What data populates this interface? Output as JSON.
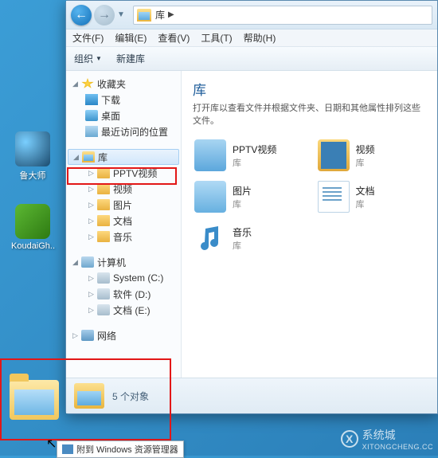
{
  "desktop": {
    "icons": [
      {
        "label": "鲁大师"
      },
      {
        "label": "KoudaiGh.."
      }
    ]
  },
  "nav": {
    "back_arrow": "←",
    "fwd_arrow": "→",
    "dropdown": "▼",
    "breadcrumb_label": "库",
    "breadcrumb_arrow": "▶"
  },
  "menu": {
    "items": [
      "文件(F)",
      "编辑(E)",
      "查看(V)",
      "工具(T)",
      "帮助(H)"
    ]
  },
  "toolbar": {
    "organize": "组织",
    "new_library": "新建库",
    "drop": "▼"
  },
  "tree": {
    "favorites": {
      "label": "收藏夹",
      "items": [
        "下载",
        "桌面",
        "最近访问的位置"
      ]
    },
    "libraries": {
      "label": "库",
      "items": [
        "PPTV视频",
        "视频",
        "图片",
        "文档",
        "音乐"
      ]
    },
    "computer": {
      "label": "计算机",
      "items": [
        "System (C:)",
        "软件 (D:)",
        "文档 (E:)"
      ]
    },
    "network": {
      "label": "网络"
    },
    "expander": "▷",
    "expander_down": "◢"
  },
  "content": {
    "title": "库",
    "subtitle": "打开库以查看文件并根据文件夹、日期和其他属性排列这些文件。",
    "items": [
      {
        "name": "PPTV视频",
        "sub": "库"
      },
      {
        "name": "视频",
        "sub": "库"
      },
      {
        "name": "图片",
        "sub": "库"
      },
      {
        "name": "文档",
        "sub": "库"
      },
      {
        "name": "音乐",
        "sub": "库"
      }
    ]
  },
  "status": {
    "text": "5 个对象"
  },
  "tooltip": {
    "text": "附到 Windows 资源管理器"
  },
  "watermark": {
    "brand": "系统城",
    "sub": "XITONGCHENG.CC",
    "x": "X"
  }
}
